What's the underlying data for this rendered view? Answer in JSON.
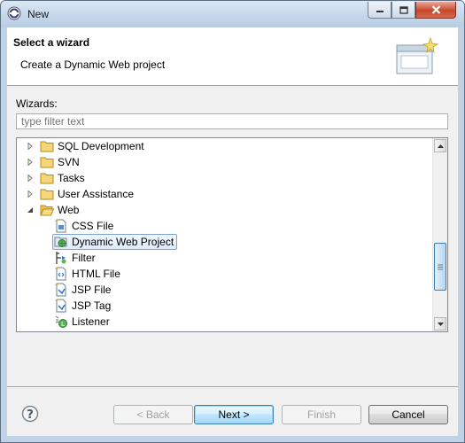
{
  "window": {
    "title": "New"
  },
  "header": {
    "title": "Select a wizard",
    "description": "Create a Dynamic Web project"
  },
  "wizards": {
    "label": "Wizards:",
    "filter_placeholder": "type filter text",
    "items": [
      {
        "label": "SQL Development",
        "kind": "folder",
        "expanded": false,
        "level": 0,
        "icon": "folder-icon"
      },
      {
        "label": "SVN",
        "kind": "folder",
        "expanded": false,
        "level": 0,
        "icon": "folder-icon"
      },
      {
        "label": "Tasks",
        "kind": "folder",
        "expanded": false,
        "level": 0,
        "icon": "folder-icon"
      },
      {
        "label": "User Assistance",
        "kind": "folder",
        "expanded": false,
        "level": 0,
        "icon": "folder-icon"
      },
      {
        "label": "Web",
        "kind": "folder",
        "expanded": true,
        "level": 0,
        "icon": "folder-open-icon"
      },
      {
        "label": "CSS File",
        "kind": "wizard",
        "level": 1,
        "icon": "css-file-icon"
      },
      {
        "label": "Dynamic Web Project",
        "kind": "wizard",
        "level": 1,
        "selected": true,
        "icon": "web-project-icon"
      },
      {
        "label": "Filter",
        "kind": "wizard",
        "level": 1,
        "icon": "filter-icon"
      },
      {
        "label": "HTML File",
        "kind": "wizard",
        "level": 1,
        "icon": "html-file-icon"
      },
      {
        "label": "JSP File",
        "kind": "wizard",
        "level": 1,
        "icon": "jsp-file-icon"
      },
      {
        "label": "JSP Tag",
        "kind": "wizard",
        "level": 1,
        "icon": "jsp-tag-icon"
      },
      {
        "label": "Listener",
        "kind": "wizard",
        "level": 1,
        "icon": "listener-icon"
      }
    ]
  },
  "buttons": {
    "back": "< Back",
    "next": "Next >",
    "finish": "Finish",
    "cancel": "Cancel"
  },
  "colors": {
    "selection_border": "#7da2ce",
    "folder": "#e8c25a",
    "accent": "#3c7fb1"
  }
}
